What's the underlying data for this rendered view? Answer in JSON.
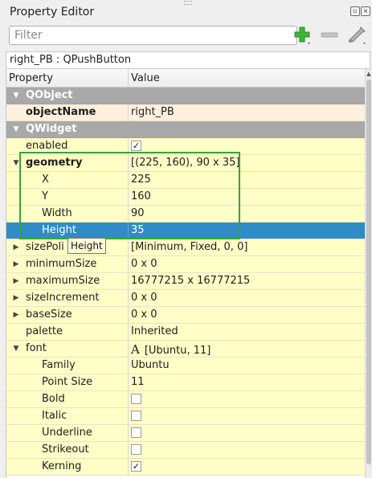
{
  "panel": {
    "title": "Property Editor"
  },
  "filter": {
    "placeholder": "Filter",
    "value": ""
  },
  "toolbar": {
    "add_icon": "plus-icon",
    "remove_icon": "minus-icon",
    "configure_icon": "wrench-icon"
  },
  "object_line": "right_PB : QPushButton",
  "columns": {
    "property": "Property",
    "value": "Value"
  },
  "rows": [
    {
      "name": "QObject",
      "value": ""
    },
    {
      "name": "objectName",
      "value": "right_PB"
    },
    {
      "name": "QWidget",
      "value": ""
    },
    {
      "name": "enabled",
      "value": "✓"
    },
    {
      "name": "geometry",
      "value": "[(225, 160), 90 x 35]"
    },
    {
      "name": "X",
      "value": "225"
    },
    {
      "name": "Y",
      "value": "160"
    },
    {
      "name": "Width",
      "value": "90"
    },
    {
      "name": "Height",
      "value": "35"
    },
    {
      "name": "sizePoli",
      "value": "[Minimum, Fixed, 0, 0]"
    },
    {
      "name": "minimumSize",
      "value": "0 x 0"
    },
    {
      "name": "maximumSize",
      "value": "16777215 x 16777215"
    },
    {
      "name": "sizeIncrement",
      "value": "0 x 0"
    },
    {
      "name": "baseSize",
      "value": "0 x 0"
    },
    {
      "name": "palette",
      "value": "Inherited"
    },
    {
      "name": "font",
      "value": "[Ubuntu, 11]"
    },
    {
      "name": "Family",
      "value": "Ubuntu"
    },
    {
      "name": "Point Size",
      "value": "11"
    },
    {
      "name": "Bold",
      "value": ""
    },
    {
      "name": "Italic",
      "value": ""
    },
    {
      "name": "Underline",
      "value": ""
    },
    {
      "name": "Strikeout",
      "value": ""
    },
    {
      "name": "Kerning",
      "value": "✓"
    }
  ],
  "font_value_glyph": "A",
  "tooltip": "Height",
  "colors": {
    "group_header": "#a9a9a9",
    "selection": "#308cc6",
    "property_row": "#fffec6",
    "highlight_box": "#37a33a"
  }
}
